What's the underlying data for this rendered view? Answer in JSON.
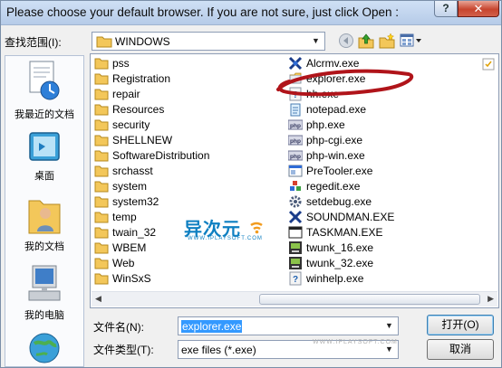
{
  "window": {
    "title": "Please choose your default browser. If you are not sure, just click Open :",
    "help_label": "?",
    "close_label": "✕"
  },
  "lookin": {
    "label": "查找范围(I):",
    "value": "WINDOWS"
  },
  "toolbar": {
    "icons": [
      "back-icon",
      "up-folder-icon",
      "new-folder-icon",
      "view-menu-icon"
    ]
  },
  "places": [
    {
      "label": "我最近的文档",
      "icon": "recent-documents-icon"
    },
    {
      "label": "桌面",
      "icon": "desktop-icon"
    },
    {
      "label": "我的文档",
      "icon": "my-documents-icon"
    },
    {
      "label": "我的电脑",
      "icon": "my-computer-icon"
    }
  ],
  "files": {
    "folders": [
      "pss",
      "Registration",
      "repair",
      "Resources",
      "security",
      "SHELLNEW",
      "SoftwareDistribution",
      "srchasst",
      "system",
      "system32",
      "temp",
      "twain_32",
      "WBEM",
      "Web",
      "WinSxS"
    ],
    "exes": [
      {
        "name": "Alcrmv.exe",
        "icon": "alcrmv-icon"
      },
      {
        "name": "explorer.exe",
        "icon": "explorer-icon"
      },
      {
        "name": "hh.exe",
        "icon": "help-icon"
      },
      {
        "name": "notepad.exe",
        "icon": "notepad-icon"
      },
      {
        "name": "php.exe",
        "icon": "php-icon"
      },
      {
        "name": "php-cgi.exe",
        "icon": "php-icon"
      },
      {
        "name": "php-win.exe",
        "icon": "php-icon"
      },
      {
        "name": "PreTooler.exe",
        "icon": "app-icon"
      },
      {
        "name": "regedit.exe",
        "icon": "regedit-icon"
      },
      {
        "name": "setdebug.exe",
        "icon": "gear-icon"
      },
      {
        "name": "SOUNDMAN.EXE",
        "icon": "soundman-icon"
      },
      {
        "name": "TASKMAN.EXE",
        "icon": "window-icon"
      },
      {
        "name": "twunk_16.exe",
        "icon": "scanner-icon"
      },
      {
        "name": "twunk_32.exe",
        "icon": "scanner-icon"
      },
      {
        "name": "winhelp.exe",
        "icon": "help-icon"
      }
    ]
  },
  "filename": {
    "label": "文件名(N):",
    "value": "explorer.exe"
  },
  "filetype": {
    "label": "文件类型(T):",
    "value": "exe files (*.exe)"
  },
  "buttons": {
    "open": "打开(O)",
    "cancel": "取消"
  },
  "watermark": {
    "text": "异次元",
    "url": "WWW.IPLAYSOFT.COM",
    "url2": "WWW.IPLAYSOFT.COM"
  },
  "colors": {
    "selection": "#3399ff",
    "folder": "#f3c75a",
    "annotation": "#b0141a",
    "brand": "#0e7fc1"
  }
}
